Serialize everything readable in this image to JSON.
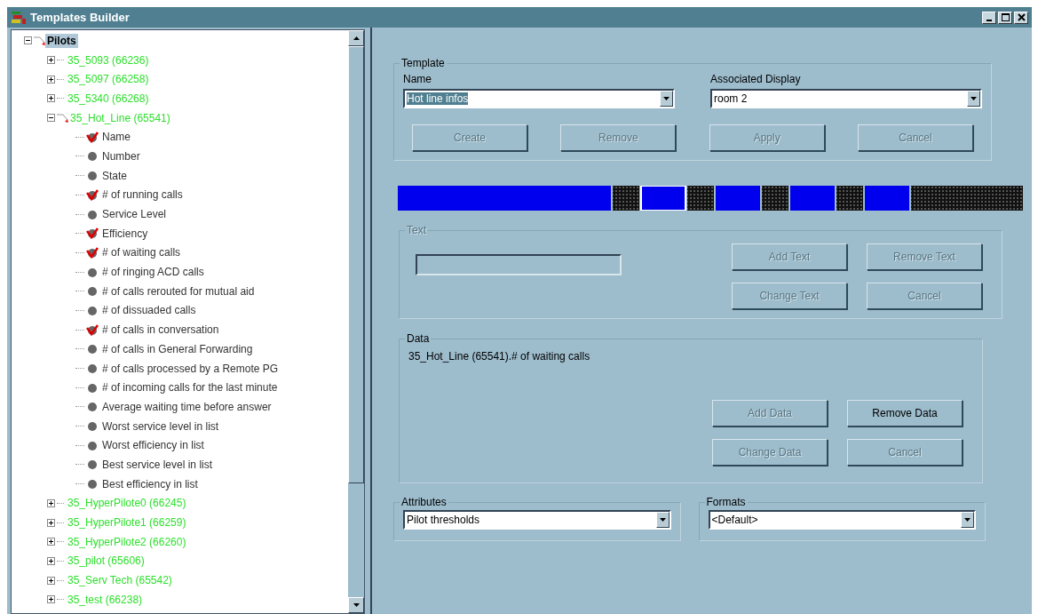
{
  "window": {
    "title": "Templates Builder"
  },
  "tree": [
    {
      "label": "Pilots",
      "selected": true,
      "expanded": true,
      "children": [
        {
          "label": "35_5093 (66236)",
          "selected": false,
          "expanded": false
        },
        {
          "label": "35_5097 (66258)",
          "selected": false,
          "expanded": false
        },
        {
          "label": "35_5340 (66268)",
          "selected": false,
          "expanded": false
        },
        {
          "label": "35_Hot_Line (65541)",
          "selected": false,
          "expanded": true,
          "children": [
            {
              "label": "Name",
              "checked": true
            },
            {
              "label": "Number",
              "checked": false
            },
            {
              "label": "State",
              "checked": false
            },
            {
              "label": "# of running calls",
              "checked": true
            },
            {
              "label": "Service Level",
              "checked": false
            },
            {
              "label": "Efficiency",
              "checked": true
            },
            {
              "label": "# of waiting calls",
              "checked": true
            },
            {
              "label": "# of ringing ACD calls",
              "checked": false
            },
            {
              "label": "# of calls rerouted for mutual aid",
              "checked": false
            },
            {
              "label": "# of dissuaded calls",
              "checked": false
            },
            {
              "label": "# of calls in conversation",
              "checked": true
            },
            {
              "label": "# of calls in General Forwarding",
              "checked": false
            },
            {
              "label": "# of calls processed by a Remote PG",
              "checked": false
            },
            {
              "label": "# of incoming calls for the last minute",
              "checked": false
            },
            {
              "label": "Average waiting time before answer",
              "checked": false
            },
            {
              "label": "Worst service level in list",
              "checked": false
            },
            {
              "label": "Worst efficiency in list",
              "checked": false
            },
            {
              "label": "Best service level in list",
              "checked": false
            },
            {
              "label": "Best efficiency in list",
              "checked": false
            }
          ]
        },
        {
          "label": "35_HyperPilote0 (66245)",
          "selected": false,
          "expanded": false
        },
        {
          "label": "35_HyperPilote1 (66259)",
          "selected": false,
          "expanded": false
        },
        {
          "label": "35_HyperPilote2 (66260)",
          "selected": false,
          "expanded": false
        },
        {
          "label": "35_pilot (65606)",
          "selected": false,
          "expanded": false
        },
        {
          "label": "35_Serv Tech (65542)",
          "selected": false,
          "expanded": false
        },
        {
          "label": "35_test (66238)",
          "selected": false,
          "expanded": false
        }
      ]
    }
  ],
  "template": {
    "title": "Template",
    "name_label": "Name",
    "name_value": "Hot line infos",
    "display_label": "Associated Display",
    "display_value": "room 2",
    "buttons": [
      {
        "label": "Create",
        "disabled": true
      },
      {
        "label": "Remove",
        "disabled": true
      },
      {
        "label": "Apply",
        "disabled": true
      },
      {
        "label": "Cancel",
        "disabled": true
      }
    ]
  },
  "text": {
    "title": "Text",
    "disabled": true,
    "buttons": [
      {
        "label": "Add Text",
        "disabled": true
      },
      {
        "label": "Remove Text",
        "disabled": true
      },
      {
        "label": "Change Text",
        "disabled": true
      },
      {
        "label": "Cancel",
        "disabled": true
      }
    ]
  },
  "data": {
    "title": "Data",
    "value": "35_Hot_Line (65541).# of waiting calls",
    "buttons": [
      {
        "label": "Add Data",
        "disabled": true
      },
      {
        "label": "Remove Data",
        "disabled": false
      },
      {
        "label": "Change Data",
        "disabled": true
      },
      {
        "label": "Cancel",
        "disabled": true
      }
    ]
  },
  "attributes": {
    "title": "Attributes",
    "value": "Pilot thresholds"
  },
  "formats": {
    "title": "Formats",
    "value": "<Default>"
  }
}
